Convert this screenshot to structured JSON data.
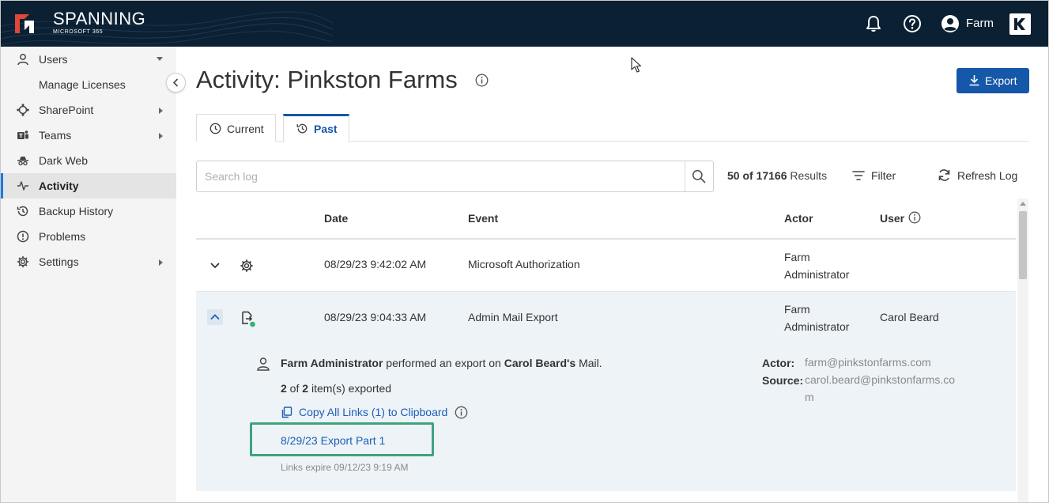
{
  "header": {
    "brand_name": "SPANNING",
    "brand_sub": "MICROSOFT 365",
    "user_name": "Farm",
    "icons": [
      "bell-icon",
      "help-icon",
      "user-avatar-icon",
      "kaseya-logo-icon"
    ],
    "colors": {
      "bar": "#0b2033",
      "logo_red": "#e0463a"
    }
  },
  "sidebar": {
    "items": [
      {
        "label": "Users",
        "icon": "user-icon",
        "caret": "down"
      },
      {
        "label": "Manage Licenses",
        "icon": "",
        "caret": ""
      },
      {
        "label": "SharePoint",
        "icon": "sharepoint-icon",
        "caret": "right"
      },
      {
        "label": "Teams",
        "icon": "teams-icon",
        "caret": "right"
      },
      {
        "label": "Dark Web",
        "icon": "spy-icon",
        "caret": ""
      },
      {
        "label": "Activity",
        "icon": "activity-icon",
        "caret": "",
        "active": true
      },
      {
        "label": "Backup History",
        "icon": "history-icon",
        "caret": ""
      },
      {
        "label": "Problems",
        "icon": "alert-circle-icon",
        "caret": ""
      },
      {
        "label": "Settings",
        "icon": "gear-icon",
        "caret": "right"
      }
    ]
  },
  "main": {
    "title": "Activity: Pinkston Farms",
    "export_label": "Export",
    "tabs": [
      {
        "label": "Current",
        "icon": "clock-icon",
        "selected": false
      },
      {
        "label": "Past",
        "icon": "history-icon",
        "selected": true
      }
    ],
    "search": {
      "placeholder": "Search log",
      "value": ""
    },
    "results": {
      "shown": "50 of 17166",
      "suffix": " Results"
    },
    "filter_label": "Filter",
    "refresh_label": "Refresh Log"
  },
  "table": {
    "columns": {
      "date": "Date",
      "event": "Event",
      "actor": "Actor",
      "user": "User"
    },
    "rows": [
      {
        "date": "08/29/23 9:42:02 AM",
        "event": "Microsoft Authorization",
        "actor": "Farm Administrator",
        "user": "",
        "type_icon": "gear-icon",
        "expanded": false
      },
      {
        "date": "08/29/23 9:04:33 AM",
        "event": "Admin Mail Export",
        "actor": "Farm Administrator",
        "user": "Carol Beard",
        "type_icon": "export-file-icon",
        "expanded": true
      }
    ]
  },
  "detail": {
    "actor_name": "Farm Administrator",
    "mid_text": " performed an export on ",
    "target": "Carol Beard's",
    "tail": " Mail.",
    "count_done": "2",
    "count_of": " of ",
    "count_total": "2",
    "count_suffix": " item(s) exported",
    "copy_link_label": "Copy All Links (1) to Clipboard",
    "export_part_label": "8/29/23 Export Part 1",
    "expire_text": "Links expire 09/12/23 9:19 AM",
    "actor_key": "Actor:",
    "actor_value": "farm@pinkstonfarms.com",
    "source_key": "Source:",
    "source_value": "carol.beard@pinkstonfarms.com"
  }
}
